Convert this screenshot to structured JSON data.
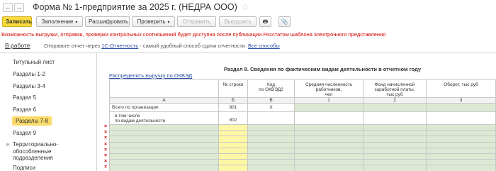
{
  "window": {
    "back_icon": "←",
    "forward_icon": "→",
    "title": "Форма № 1-предприятие за 2025 г. (НЕДРА ООО)",
    "star_icon": "☆"
  },
  "toolbar": {
    "record": "Записать",
    "fill": "Заполнение",
    "decode": "Расшифровать",
    "check": "Проверить",
    "send": "Отправить",
    "upload": "Выгрузить",
    "print_icon": "🖶",
    "attach_icon": "📎",
    "dropdown_arrow": "▾"
  },
  "warning": "Возможность выгрузки, отправки, проверки контрольных соотношений будет доступна после публикации Росстатом шаблона электронного представления",
  "status": {
    "in_work": "В работе",
    "text_before": "Отправьте отчет через",
    "link_1c": "1С-Отчетность",
    "text_after": "- самый удобный способ сдачи отчетности.",
    "all_methods": "Все способы"
  },
  "sidebar": {
    "items": [
      "Титульный лист",
      "Разделы 1-2",
      "Разделы 3-4",
      "Раздел 5",
      "Раздел 6",
      "Разделы 7-8",
      "Раздел 9",
      "Территориально-обособленные подразделения",
      "Подписи"
    ],
    "territorial_line1": "Территориально-",
    "territorial_line2": "обособленные",
    "territorial_line3": "подразделения",
    "expand_icon": "⊕"
  },
  "form": {
    "section_title": "Раздел 8. Сведения по фактическим видам деятельности в отчетном году",
    "distribute_link": "Распределить выручку по ОКВЭД",
    "headers": {
      "line_no": "№ строки",
      "okved_1": "Код",
      "okved_2": "по ОКВЭД2",
      "avg_1": "Средняя численность",
      "avg_2": "работников,",
      "avg_3": "чел",
      "fund_1": "Фонд начисленной",
      "fund_2": "заработной платы,",
      "fund_3": "тыс руб",
      "turnover": "Оборот, тыс руб"
    },
    "col_index": [
      "А",
      "Б",
      "В",
      "1",
      "2",
      "3"
    ],
    "row_total_label": "Всего по организации",
    "row_total_code": "801",
    "row_total_okved": "Х",
    "row_incl_1": "в том числе",
    "row_incl_2": "по видам деятельности",
    "row_incl_code": "802",
    "delete_mark": "×"
  }
}
